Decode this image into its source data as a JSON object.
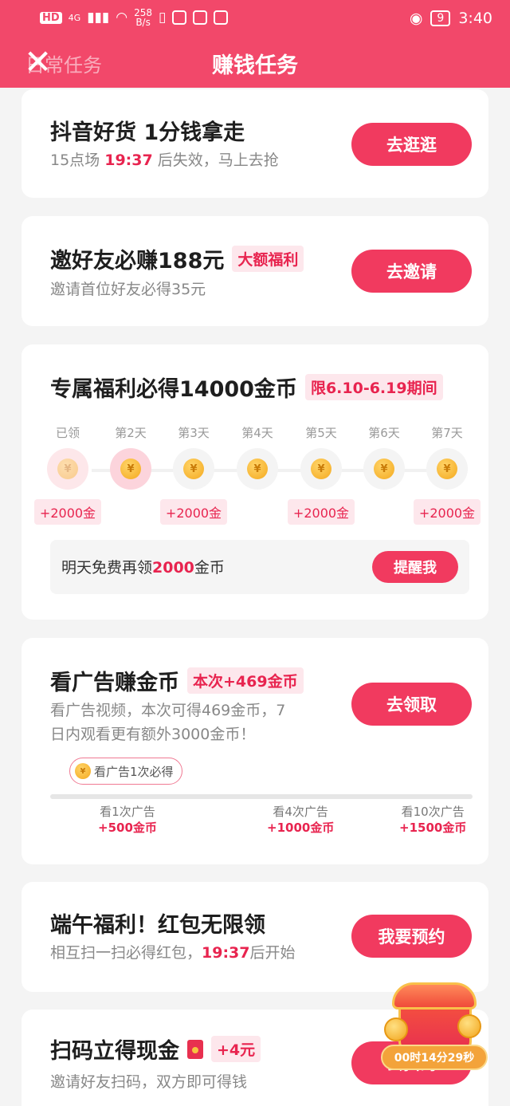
{
  "status_bar": {
    "left_text": "HD",
    "network": "4G",
    "speed_value": "258",
    "speed_unit": "B/s",
    "battery": "9",
    "time": "3:40"
  },
  "header": {
    "title": "赚钱任务",
    "back_tab": "日常任务"
  },
  "tasks": {
    "task1": {
      "title": "抖音好货 1分钱拿走",
      "sub_pre": "15点场 ",
      "sub_time": "19:37",
      "sub_post": " 后失效，马上去抢",
      "button": "去逛逛"
    },
    "task2": {
      "title": "邀好友必赚188元",
      "tag": "大额福利",
      "sub": "邀请首位好友必得35元",
      "button": "去邀请"
    },
    "task3": {
      "title": "专属福利必得14000金币",
      "tag": "限6.10-6.19期间",
      "days": [
        {
          "label": "已领",
          "bonus": "+2000金"
        },
        {
          "label": "第2天",
          "bonus": ""
        },
        {
          "label": "第3天",
          "bonus": "+2000金"
        },
        {
          "label": "第4天",
          "bonus": ""
        },
        {
          "label": "第5天",
          "bonus": "+2000金"
        },
        {
          "label": "第6天",
          "bonus": ""
        },
        {
          "label": "第7天",
          "bonus": "+2000金"
        }
      ],
      "remind_pre": "明天免费再领",
      "remind_amount": "2000",
      "remind_post": "金币",
      "remind_button": "提醒我"
    },
    "task4": {
      "title": "看广告赚金币",
      "tag": "本次+469金币",
      "sub_line1": "看广告视频，本次可得469金币，7",
      "sub_line2": "日内观看更有额外3000金币！",
      "button": "去领取",
      "bubble": "看广告1次必得",
      "milestones": [
        {
          "label": "看1次广告",
          "reward": "+500金币"
        },
        {
          "label": "看4次广告",
          "reward": "+1000金币"
        },
        {
          "label": "看10次广告",
          "reward": "+1500金币"
        }
      ]
    },
    "task5": {
      "title": "端午福利！红包无限领",
      "sub_pre": "相互扫一扫必得红包，",
      "sub_time": "19:37",
      "sub_post": "后开始",
      "button": "我要预约"
    },
    "task6": {
      "title": "扫码立得现金",
      "tag": "+4元",
      "sub": "邀请好友扫码，双方即可得钱",
      "button": "去扫码"
    }
  },
  "floating_chest": {
    "timer": "00时14分29秒"
  },
  "colors": {
    "accent": "#f13a5f",
    "header": "#f2486a",
    "highlight": "#e8244f"
  }
}
